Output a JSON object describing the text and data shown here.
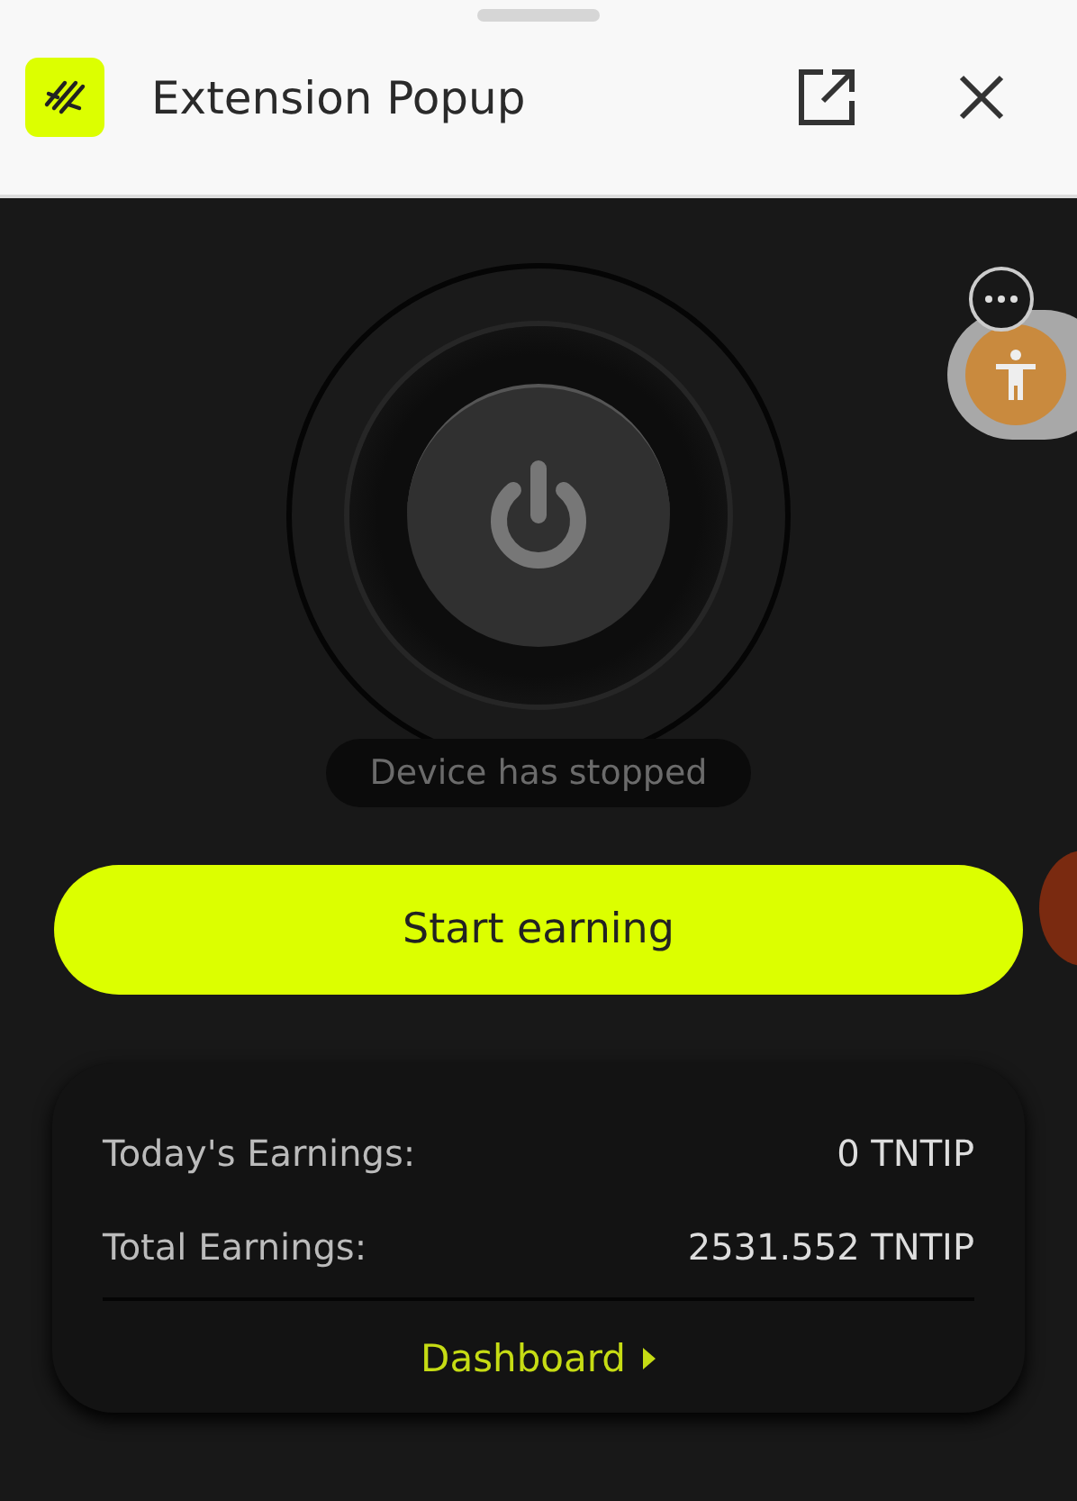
{
  "window": {
    "title": "Extension Popup"
  },
  "device": {
    "status": "Device has stopped",
    "running": false
  },
  "primary_button": {
    "label": "Start earning"
  },
  "earnings": [
    {
      "label": "Today's Earnings:",
      "value": "0 TNTIP"
    },
    {
      "label": "Total Earnings:",
      "value": "2531.552 TNTIP"
    }
  ],
  "dashboard_link": {
    "label": "Dashboard"
  }
}
